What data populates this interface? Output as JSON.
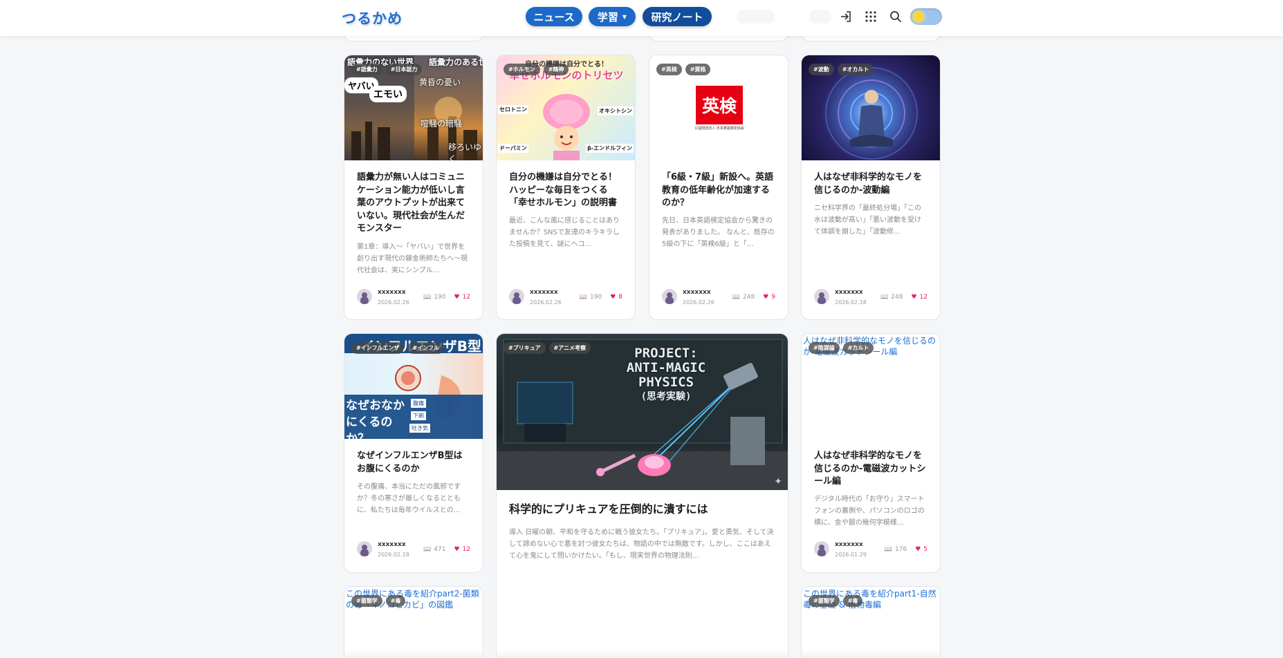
{
  "header": {
    "logo": "つるかめ",
    "nav": {
      "news": "ニュース",
      "learn": "学習",
      "research": "研究ノート"
    },
    "icons": [
      "login-icon",
      "apps-grid-icon",
      "search-icon",
      "theme-toggle"
    ]
  },
  "cards": [
    {
      "tags": [
        "#語彙力",
        "#日本語力"
      ],
      "image_text": [
        "語彙力のない世界",
        "語彙力のある世界",
        "ヤバい",
        "エモい",
        "黄昏の憂い",
        "喧騒の暗騒",
        "移ろいゆく"
      ],
      "title": "語彙力が無い人はコミュニケーション能力が低いし言葉のアウトプットが出来ていない。現代社会が生んだモンスター",
      "excerpt": "第1章：導入〜「ヤバい」で世界を創り出す現代の錬金術師たちへ〜現代社会は、実にシンプル…",
      "author": "xxxxxxx",
      "date": "2026.02.26",
      "views": "190",
      "likes": "12"
    },
    {
      "tags": [
        "#ホルモン",
        "#精神"
      ],
      "image_text": [
        "自分の機嫌は自分でとる！",
        "幸せホルモンのトリセツ",
        "セロトニン",
        "オキシトシン",
        "ドーパミン",
        "β-エンドルフィン"
      ],
      "title": "自分の機嫌は自分でとる！ハッピーな毎日をつくる「幸せホルモン」の説明書",
      "excerpt": "最近、こんな風に感じることはありませんか？SNSで友達のキラキラした投稿を見て、謎にヘコ…",
      "author": "xxxxxxx",
      "date": "2026.02.26",
      "views": "190",
      "likes": "8"
    },
    {
      "tags": [
        "#英検",
        "#資格"
      ],
      "image_text": [
        "英検",
        "公益財団法人 日本英語検定協会"
      ],
      "title": "「6級・7級」新設へ。英語教育の低年齢化が加速するのか？",
      "excerpt": "先日、日本英語検定協会から驚きの発表がありました。 なんと、既存の5級の下に「英検6級」と「…",
      "author": "xxxxxxx",
      "date": "2026.02.26",
      "views": "248",
      "likes": "9"
    },
    {
      "tags": [
        "#波動",
        "#オカルト"
      ],
      "title": "人はなぜ非科学的なモノを信じるのか-波動編",
      "excerpt": "ニセ科学界の「最終処分場」「この水は波動が高い」「悪い波動を受けて体調を崩した」「波動修…",
      "author": "xxxxxxx",
      "date": "2026.02.18",
      "views": "248",
      "likes": "12"
    },
    {
      "tags": [
        "#インフルエンザ",
        "#インフル"
      ],
      "image_text": [
        "インフルエンザB型",
        "なぜおなかにくるのか？",
        "腹痛",
        "下痢",
        "吐き気"
      ],
      "title": "なぜインフルエンザB型はお腹にくるのか",
      "excerpt": "その腹痛、本当にただの風邪ですか？冬の寒さが厳しくなるとともに、私たちは毎年ウイルスとの…",
      "author": "xxxxxxx",
      "date": "2026.02.18",
      "views": "471",
      "likes": "12"
    },
    {
      "tags": [
        "#プリキュア",
        "#アニメ考察"
      ],
      "image_text": [
        "PROJECT:",
        "ANTI-MAGIC",
        "PHYSICS",
        "(思考実験)"
      ],
      "title": "科学的にプリキュアを圧倒的に潰すには",
      "excerpt": "導入 日曜の朝、平和を守るために戦う彼女たち。「プリキュア」。愛と勇気、そして決して諦めない心で悪を討つ彼女たちは、物語の中では無敵です。しかし、ここはあえて心を鬼にして問いかけたい。「もし、現実世界の物理法則…"
    },
    {
      "tags": [
        "#陰謀論",
        "#カルト"
      ],
      "image_alt": "人はなぜ非科学的なモノを信じるのか-電磁波カットシール編",
      "title": "人はなぜ非科学的なモノを信じるのか-電磁波カットシール編",
      "excerpt": "デジタル時代の「お守り」スマートフォンの裏側や、パソコンのロゴの横に、金や銀の幾何学模様…",
      "author": "xxxxxxx",
      "date": "2026.01.29",
      "views": "176",
      "likes": "5"
    },
    {
      "tags": [
        "#菌類学",
        "#毒"
      ],
      "image_alt": "この世界にある毒を紹介part2-菌類の毒「キノコとカビ」の図鑑"
    },
    {
      "tags": [
        "#菌類学",
        "#毒"
      ],
      "image_alt": "この世界にある毒を紹介part1-自然毒の基礎 & 植物毒編"
    }
  ]
}
